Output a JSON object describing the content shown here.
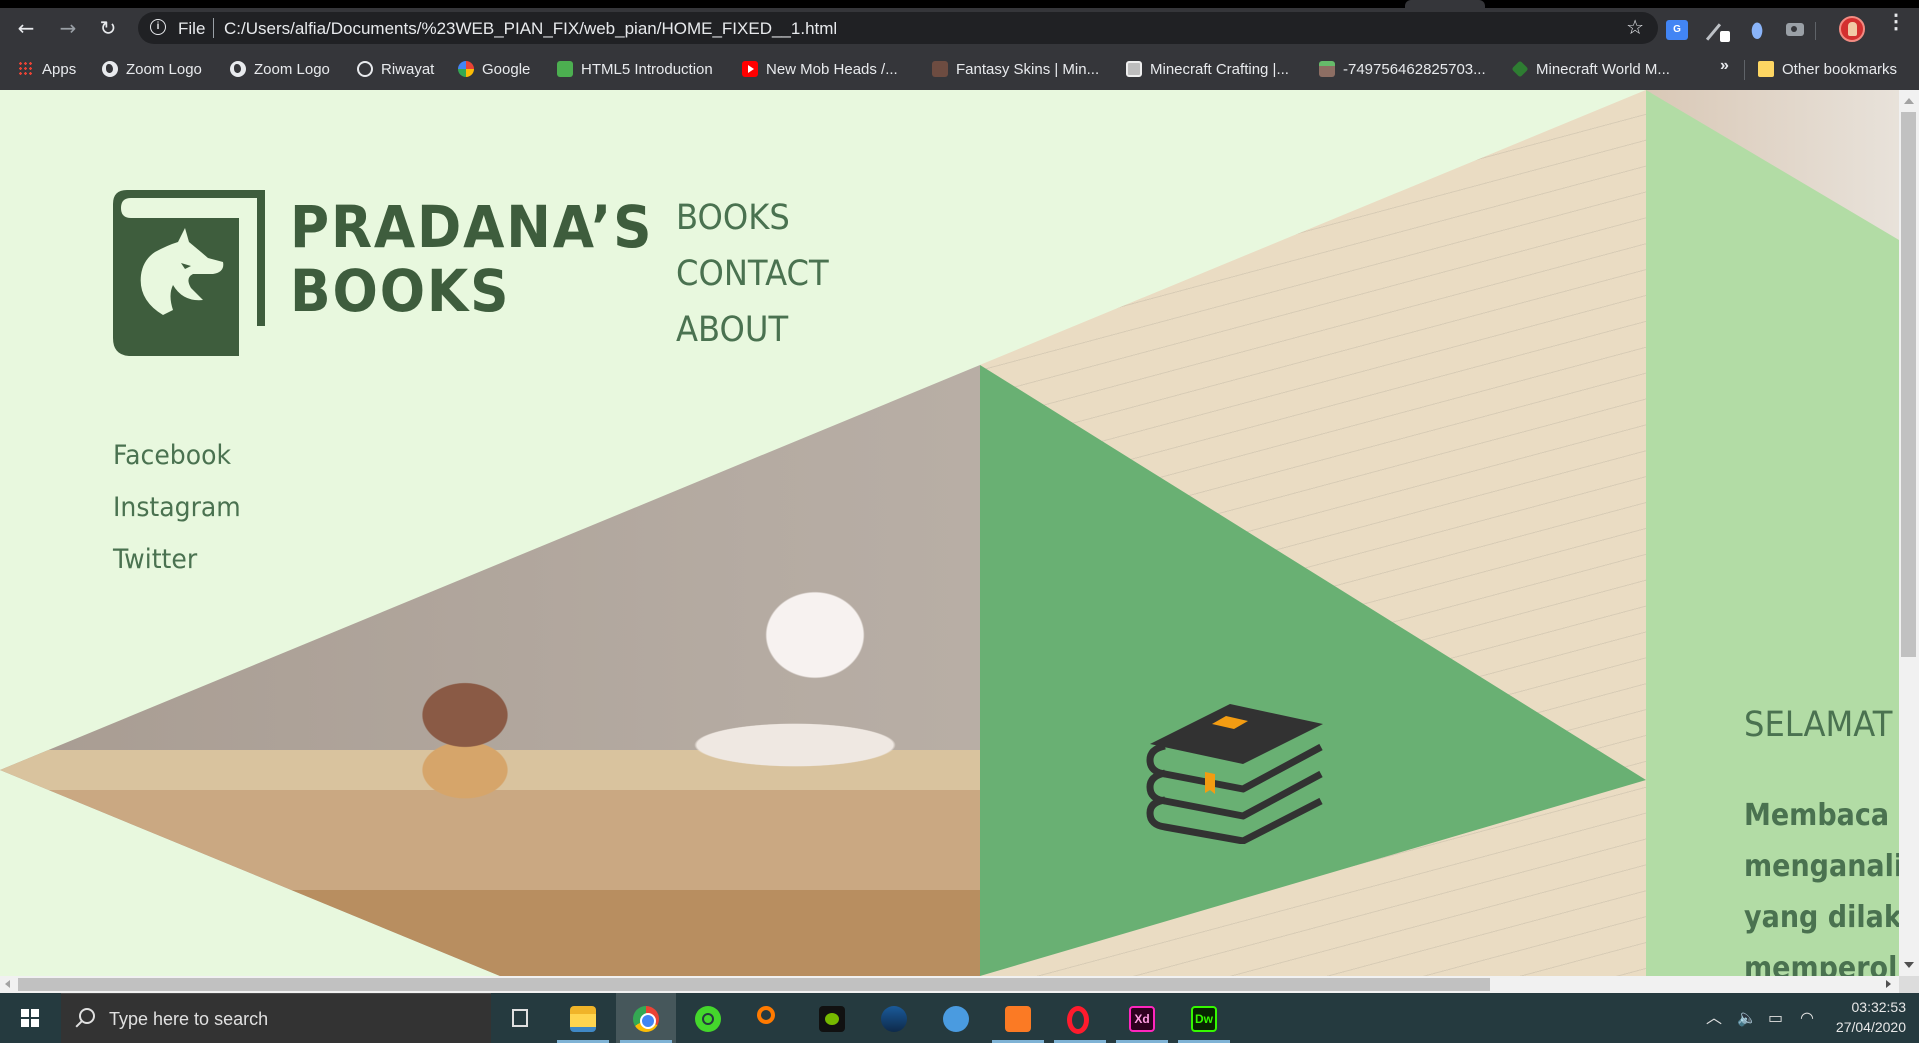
{
  "browser": {
    "address_scheme": "File",
    "url": "C:/Users/alfia/Documents/%23WEB_PIAN_FIX/web_pian/HOME_FIXED__1.html",
    "bookmarks": [
      {
        "label": "Apps",
        "icon": "apps-grid-icon"
      },
      {
        "label": "Zoom Logo",
        "icon": "globe-icon"
      },
      {
        "label": "Zoom Logo",
        "icon": "globe-icon"
      },
      {
        "label": "Riwayat",
        "icon": "history-icon"
      },
      {
        "label": "Google",
        "icon": "google-icon"
      },
      {
        "label": "HTML5 Introduction",
        "icon": "w3schools-icon"
      },
      {
        "label": "New Mob Heads /...",
        "icon": "youtube-icon"
      },
      {
        "label": "Fantasy Skins | Min...",
        "icon": "minecraft-head-icon"
      },
      {
        "label": "Minecraft Crafting |...",
        "icon": "book-icon"
      },
      {
        "label": "-749756462825703...",
        "icon": "dirt-block-icon"
      },
      {
        "label": "Minecraft World M...",
        "icon": "grass-block-icon"
      }
    ],
    "bookmarks_overflow": "»",
    "other_bookmarks": "Other bookmarks",
    "translate_badge": "G"
  },
  "page": {
    "brand_line1": "PRADANA’S",
    "brand_line2": "BOOKS",
    "nav": [
      "BOOKS",
      "CONTACT",
      "ABOUT"
    ],
    "social": [
      "Facebook",
      "Instagram",
      "Twitter"
    ],
    "welcome_heading": "SELAMAT",
    "intro_lines": [
      "Membaca a",
      "menganalis",
      "yang dilaku",
      "memperol"
    ],
    "colors": {
      "background": "#e8f8de",
      "brand_green": "#3e5d3d",
      "text_green": "#4a7250",
      "triangle_green": "#69b073",
      "panel_green": "#b2dca5",
      "bookmark_accent": "#f5a623"
    }
  },
  "taskbar": {
    "search_placeholder": "Type here to search",
    "apps": [
      "Task View",
      "File Explorer",
      "Google Chrome",
      "Razer Cortex",
      "Search",
      "NVIDIA GeForce Experience",
      "Steam",
      "App",
      "XAMPP",
      "Opera",
      "Adobe XD",
      "Dreamweaver"
    ],
    "xd_label": "Xd",
    "dw_label": "Dw",
    "time": "03:32:53",
    "date": "27/04/2020"
  }
}
